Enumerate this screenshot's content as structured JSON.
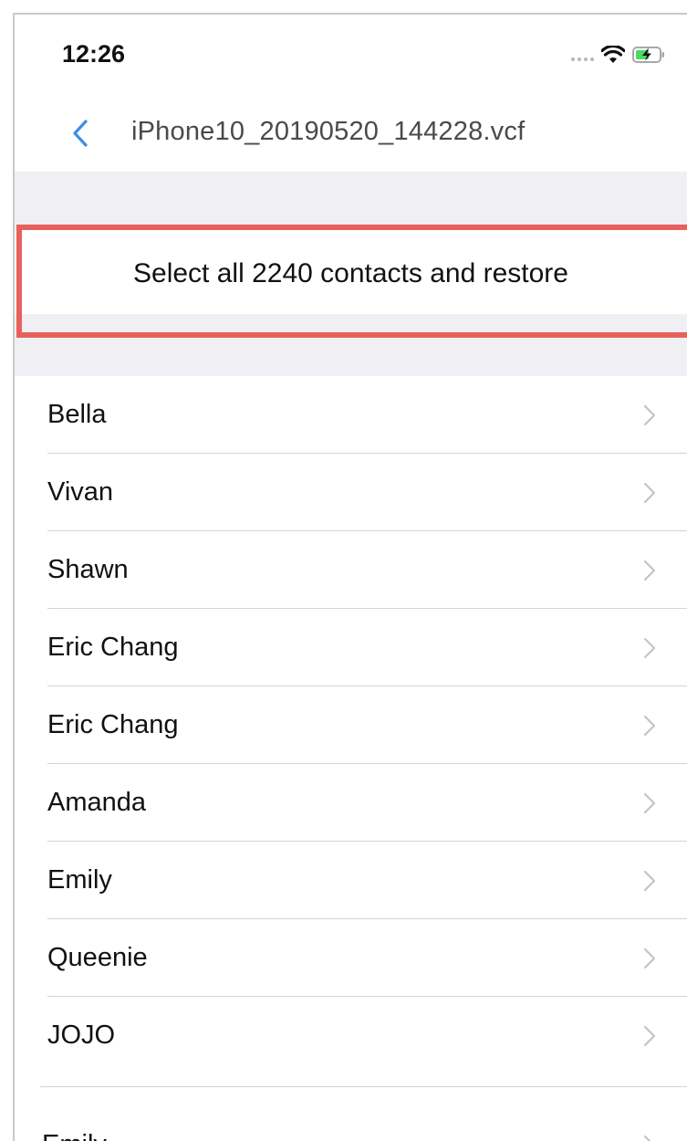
{
  "status_bar": {
    "time": "12:26",
    "icons": [
      "signal-dots-icon",
      "wifi-icon",
      "battery-charging-icon"
    ]
  },
  "nav": {
    "back_icon": "chevron-left-icon",
    "title": "iPhone10_20190520_144228.vcf"
  },
  "select_all": {
    "label": "Select all 2240 contacts and restore"
  },
  "contacts": [
    {
      "name": "Bella"
    },
    {
      "name": "Vivan"
    },
    {
      "name": "Shawn"
    },
    {
      "name": "Eric Chang"
    },
    {
      "name": "Eric Chang"
    },
    {
      "name": "Amanda"
    },
    {
      "name": "Emily"
    },
    {
      "name": "Queenie"
    },
    {
      "name": "JOJO"
    },
    {
      "name": "Emily"
    }
  ],
  "colors": {
    "accent": "#3d8ee6",
    "highlight": "#e8605c",
    "group_background": "#efeff4",
    "battery_fill": "#4cd964"
  }
}
